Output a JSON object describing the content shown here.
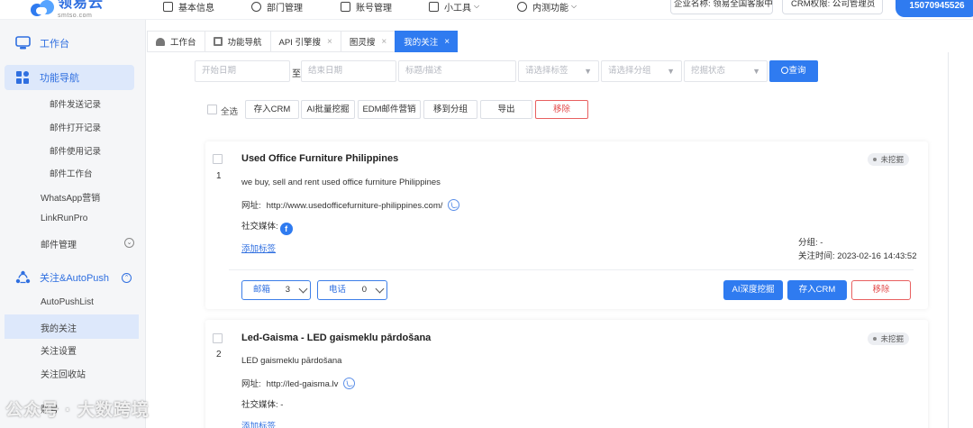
{
  "brand": {
    "name": "领易云",
    "domain": "smtso.com",
    "accent": "#2f7bf0"
  },
  "topnav": {
    "items": [
      {
        "label": "基本信息"
      },
      {
        "label": "部门管理"
      },
      {
        "label": "账号管理"
      },
      {
        "label": "小工具"
      },
      {
        "label": "内测功能"
      }
    ],
    "company": "企业名称: 领易全国客服中心",
    "crm_permission": "CRM权限: 公司管理员",
    "phone": "15070945526"
  },
  "sidebar": {
    "workbench": "工作台",
    "func_nav": "功能导航",
    "func_items": [
      "邮件发送记录",
      "邮件打开记录",
      "邮件使用记录",
      "邮件工作台"
    ],
    "whatsapp": "WhatsApp营销",
    "linkrun": "LinkRunPro",
    "mail_mgmt": "邮件管理",
    "follow": "关注&AutoPush",
    "follow_items": [
      "AutoPushList",
      "我的关注",
      "关注设置",
      "关注回收站"
    ],
    "bottom_item": "账号"
  },
  "tabs": [
    {
      "label": "工作台"
    },
    {
      "label": "功能导航"
    },
    {
      "label": "API 引擎搜"
    },
    {
      "label": "图灵搜"
    },
    {
      "label": "我的关注"
    }
  ],
  "filters": {
    "start_date": "开始日期",
    "to": "至",
    "end_date": "结束日期",
    "title_desc": "标题/描述",
    "tag": "请选择标签",
    "group": "请选择分组",
    "mine_status": "挖掘状态",
    "query": "查询"
  },
  "actions": {
    "select_all": "全选",
    "save_crm": "存入CRM",
    "ai_batch": "AI批量挖掘",
    "edm": "EDM邮件营销",
    "move_group": "移到分组",
    "export": "导出",
    "remove": "移除"
  },
  "labels": {
    "website": "网址:",
    "social": "社交媒体:",
    "add_tag": "添加标签",
    "group": "分组: -",
    "follow_time_prefix": "关注时间:",
    "email": "邮箱",
    "phone": "电话",
    "ai_deep": "AI深度挖掘",
    "save_crm": "存入CRM",
    "remove": "移除",
    "status": "未挖掘"
  },
  "cards": [
    {
      "index": "1",
      "title": "Used Office Furniture Philippines",
      "description": "we buy, sell and rent used office furniture Philippines",
      "website": "http://www.usedofficefurniture-philippines.com/",
      "social_icon": "facebook-icon",
      "group": "分组: -",
      "follow_time": "2023-02-16 14:43:52",
      "email_count": "3",
      "phone_count": "0"
    },
    {
      "index": "2",
      "title": "Led-Gaisma - LED gaismeklu pārdošana",
      "description": "LED gaismeklu pārdošana",
      "website": "http://led-gaisma.lv",
      "social": "-"
    }
  ],
  "watermark": "公众号 · 大数跨境"
}
